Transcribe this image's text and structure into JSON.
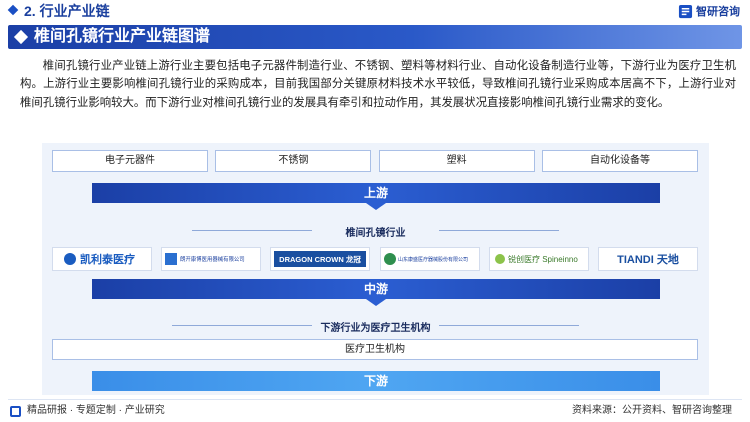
{
  "header": {
    "section_title": "2. 行业产业链",
    "brand_name": "智研咨询",
    "brand_icon": "zhiyan-logo-icon"
  },
  "title_bar": {
    "title": "椎间孔镜行业产业链图谱"
  },
  "intro_paragraph": "椎间孔镜行业产业链上游行业主要包括电子元器件制造行业、不锈钢、塑料等材料行业、自动化设备制造行业等，下游行业为医疗卫生机构。上游行业主要影响椎间孔镜行业的采购成本，目前我国部分关键原材料技术水平较低，导致椎间孔镜行业采购成本居高不下，上游行业对椎间孔镜行业影响较大。而下游行业对椎间孔镜行业的发展具有牵引和拉动作用，其发展状况直接影响椎间孔镜行业需求的变化。",
  "diagram": {
    "upstream_items": [
      "电子元器件",
      "不锈钢",
      "塑料",
      "自动化设备等"
    ],
    "upstream_band": "上游",
    "midstream_title": "椎间孔镜行业",
    "midstream_companies": [
      {
        "name": "凯利泰医疗",
        "icon": "kaliitai-logo-icon"
      },
      {
        "name": "朗开康博医用器械有限公司",
        "icon": "kangbo-logo-icon"
      },
      {
        "name": "DRAGON CROWN 龙冠",
        "icon": "dragon-crown-logo-icon"
      },
      {
        "name": "山东康盛医疗器械股份有限公司",
        "icon": "kangsheng-logo-icon"
      },
      {
        "name": "锐创医疗 Spineinno",
        "icon": "spineinno-logo-icon"
      },
      {
        "name": "TIANDI 天地",
        "icon": "tiandi-logo-icon"
      }
    ],
    "midstream_band": "中游",
    "downstream_title": "下游行业为医疗卫生机构",
    "downstream_item": "医疗卫生机构",
    "downstream_band": "下游"
  },
  "footer": {
    "left_text": "精品研报 · 专题定制 · 产业研究",
    "source_text": "资料来源：公开资料、智研咨询整理"
  },
  "colors": {
    "primary_blue": "#1b3fa6",
    "accent_blue": "#2b5ed2",
    "light_band": "#eef3fb"
  }
}
